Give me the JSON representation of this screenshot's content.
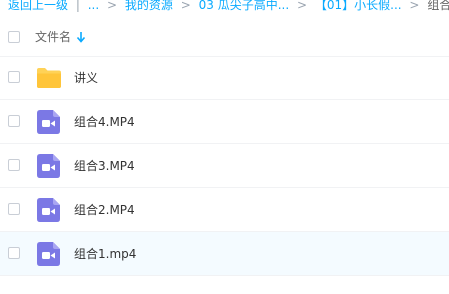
{
  "breadcrumb": {
    "back": "返回上一级",
    "ellipsis": "...",
    "items": [
      "我的资源",
      "03 瓜尖子高中...",
      "【01】小长假...",
      "组合"
    ]
  },
  "header": {
    "column_name": "文件名"
  },
  "files": [
    {
      "name": "讲义",
      "type": "folder"
    },
    {
      "name": "组合4.MP4",
      "type": "video"
    },
    {
      "name": "组合3.MP4",
      "type": "video"
    },
    {
      "name": "组合2.MP4",
      "type": "video"
    },
    {
      "name": "组合1.mp4",
      "type": "video"
    }
  ],
  "colors": {
    "link": "#09aaff",
    "folder": "#ffd257",
    "video": "#7b78e5",
    "row_hover": "#f4fbff"
  }
}
